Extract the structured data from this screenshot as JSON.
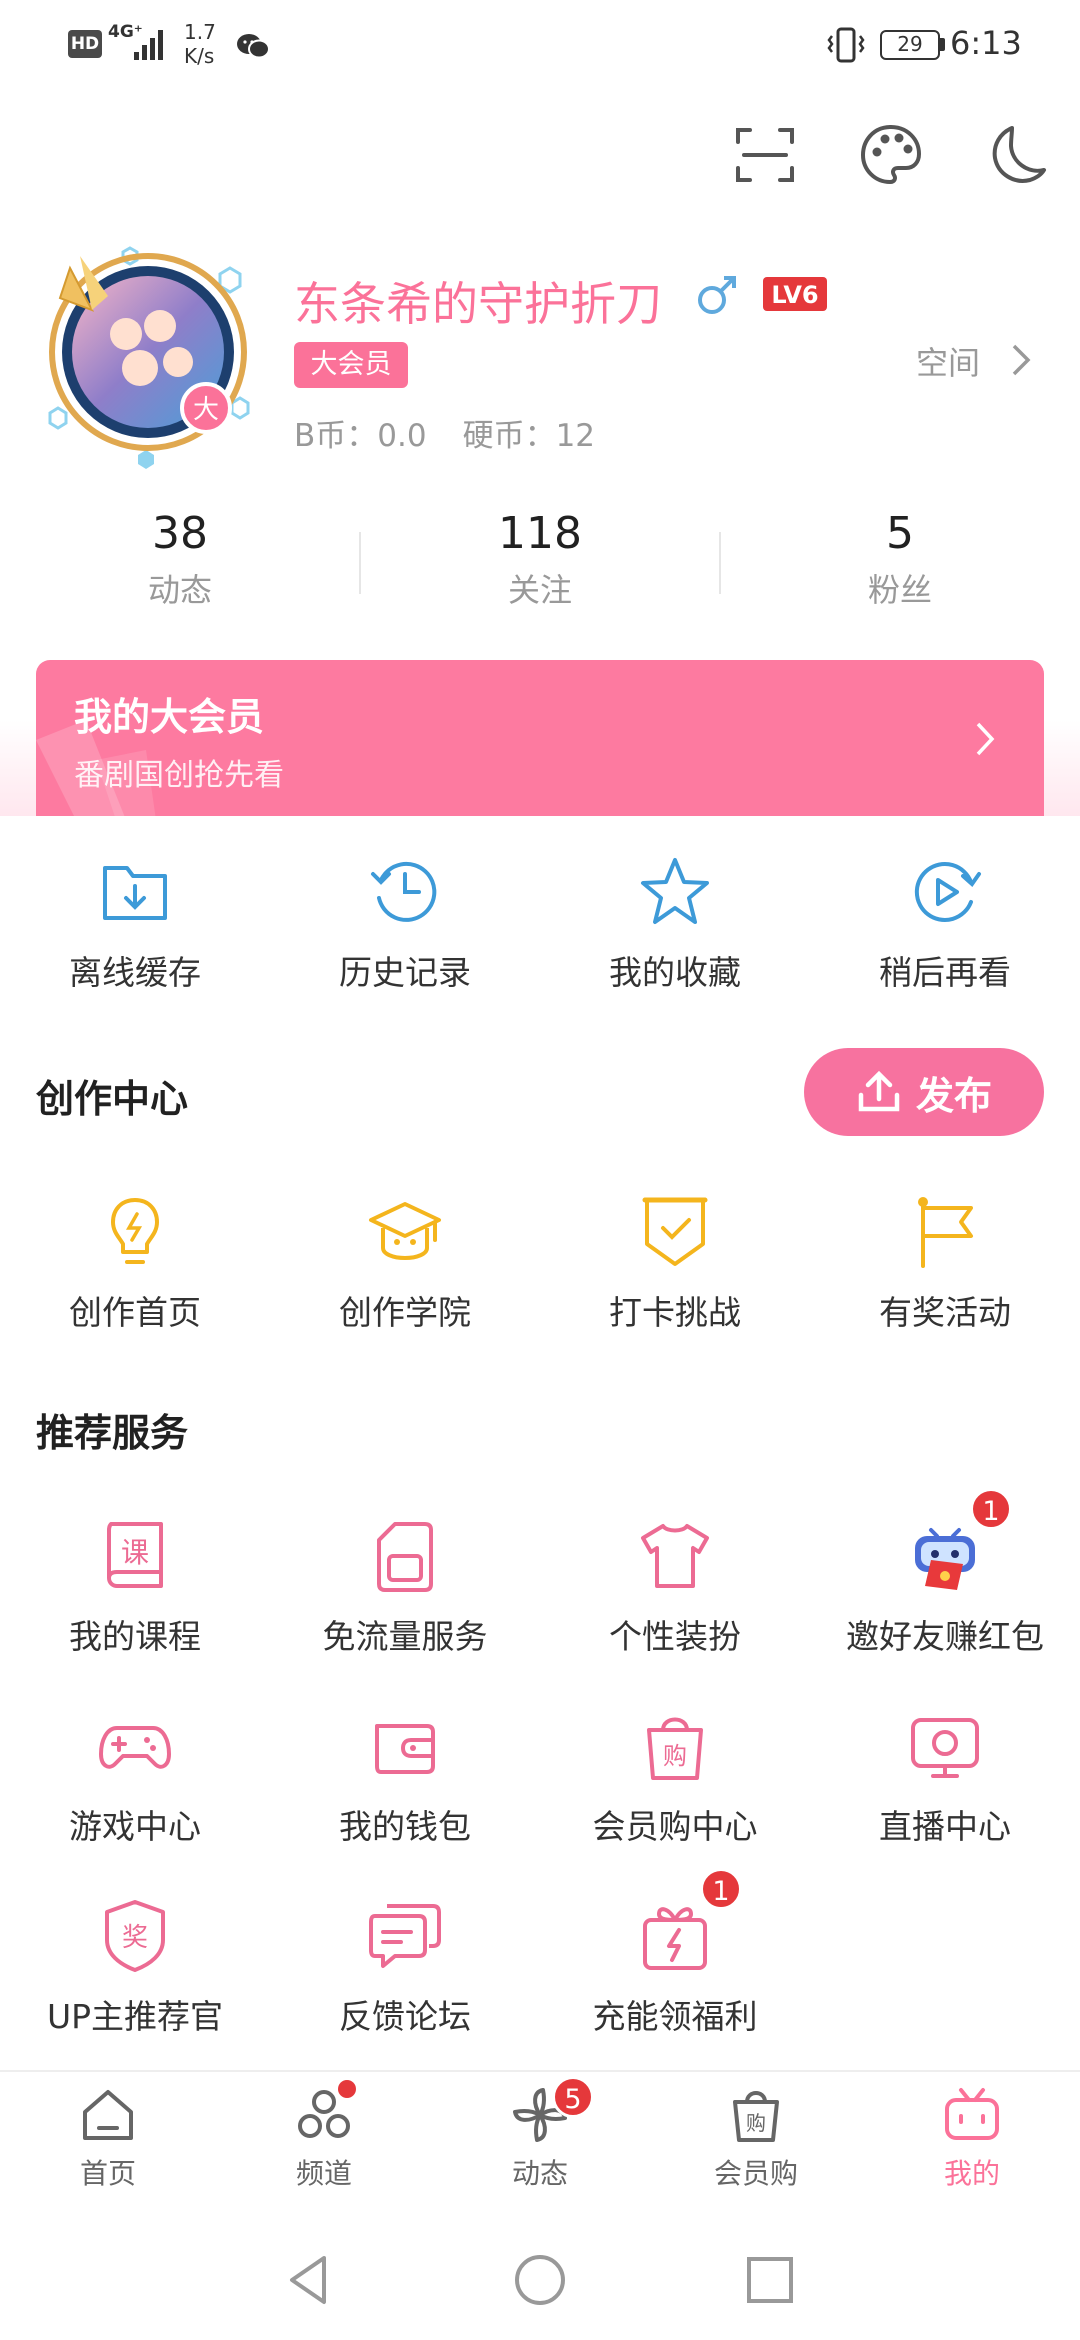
{
  "status_bar": {
    "hd": "HD",
    "network": "4G⁺",
    "speed_value": "1.7",
    "speed_unit": "K/s",
    "battery": "29",
    "time": "6:13"
  },
  "top_actions": {
    "scan_icon": "scan-icon",
    "theme_icon": "palette-icon",
    "night_icon": "moon-icon"
  },
  "profile": {
    "username": "东条希的守护折刀",
    "level": "LV6",
    "vip_tag": "大会员",
    "avatar_badge": "大",
    "space_label": "空间",
    "bcoin_label": "B币：0.0",
    "coin_label": "硬币：12"
  },
  "stats": [
    {
      "value": "38",
      "label": "动态"
    },
    {
      "value": "118",
      "label": "关注"
    },
    {
      "value": "5",
      "label": "粉丝"
    }
  ],
  "vip_banner": {
    "title": "我的大会员",
    "subtitle": "番剧国创抢先看"
  },
  "quick_actions": [
    {
      "label": "离线缓存",
      "icon": "download-folder-icon"
    },
    {
      "label": "历史记录",
      "icon": "history-clock-icon"
    },
    {
      "label": "我的收藏",
      "icon": "star-icon"
    },
    {
      "label": "稍后再看",
      "icon": "watch-later-icon"
    }
  ],
  "creation_center": {
    "title": "创作中心",
    "publish_label": "发布",
    "items": [
      {
        "label": "创作首页",
        "icon": "lightbulb-icon"
      },
      {
        "label": "创作学院",
        "icon": "graduation-cap-icon"
      },
      {
        "label": "打卡挑战",
        "icon": "check-shield-icon"
      },
      {
        "label": "有奖活动",
        "icon": "flag-icon"
      }
    ]
  },
  "recommended": {
    "title": "推荐服务",
    "items": [
      {
        "label": "我的课程",
        "icon": "course-book-icon",
        "glyph": "课"
      },
      {
        "label": "免流量服务",
        "icon": "sim-card-icon"
      },
      {
        "label": "个性装扮",
        "icon": "tshirt-icon"
      },
      {
        "label": "邀好友赚红包",
        "icon": "robot-red-envelope-icon",
        "badge": "1"
      },
      {
        "label": "游戏中心",
        "icon": "gamepad-icon"
      },
      {
        "label": "我的钱包",
        "icon": "wallet-icon"
      },
      {
        "label": "会员购中心",
        "icon": "shopping-bag-icon",
        "glyph": "购"
      },
      {
        "label": "直播中心",
        "icon": "live-tv-icon"
      },
      {
        "label": "UP主推荐官",
        "icon": "award-badge-icon",
        "glyph": "奖"
      },
      {
        "label": "反馈论坛",
        "icon": "chat-bubbles-icon"
      },
      {
        "label": "充能领福利",
        "icon": "gift-bolt-icon",
        "badge": "1"
      }
    ]
  },
  "bottom_nav": [
    {
      "label": "首页",
      "icon": "home-icon"
    },
    {
      "label": "频道",
      "icon": "channel-circles-icon"
    },
    {
      "label": "动态",
      "icon": "pinwheel-icon",
      "badge": "5"
    },
    {
      "label": "会员购",
      "icon": "shopping-bag-icon",
      "glyph": "购"
    },
    {
      "label": "我的",
      "icon": "tv-face-icon",
      "active": true
    }
  ],
  "colors": {
    "accent_pink": "#fb7299",
    "blue_icon": "#3d9ad8",
    "yellow_icon": "#f4b51d",
    "badge_red": "#e5383b"
  }
}
